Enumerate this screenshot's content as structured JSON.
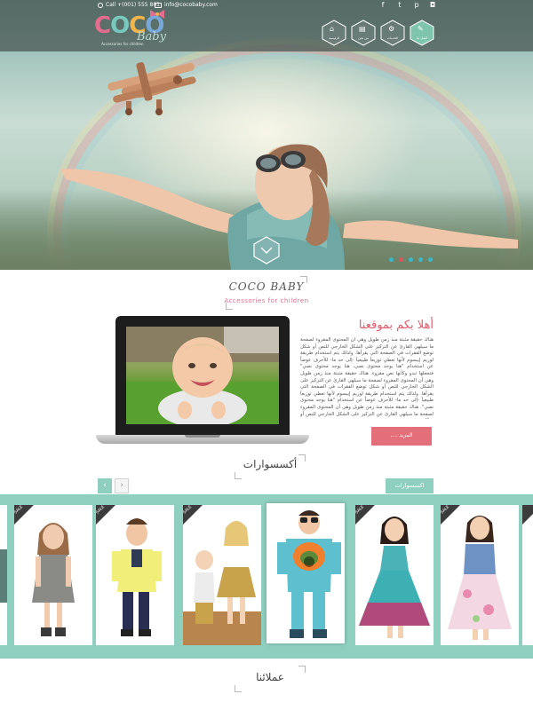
{
  "topbar": {
    "phone": "Call +(001) 555 801",
    "email": "info@cocobaby.com",
    "social": [
      {
        "name": "facebook-icon",
        "glyph": "f"
      },
      {
        "name": "twitter-icon",
        "glyph": "t"
      },
      {
        "name": "pinterest-icon",
        "glyph": "p"
      },
      {
        "name": "instagram-icon",
        "glyph": "◘"
      }
    ],
    "nav": [
      {
        "name": "nav-home",
        "label": "الرئيسية",
        "glyph": "⌂"
      },
      {
        "name": "nav-about",
        "label": "من نحن",
        "glyph": "▤"
      },
      {
        "name": "nav-services",
        "label": "الخدمات",
        "glyph": "⚙"
      },
      {
        "name": "nav-contact",
        "label": "اتصل بنا",
        "glyph": "✎"
      }
    ]
  },
  "logo": {
    "letters": [
      "C",
      "O",
      "C",
      "O"
    ],
    "script": "Baby",
    "tagline": "Accessories for children"
  },
  "hero": {
    "slides": 5,
    "active_slide": 1
  },
  "brand": {
    "title": "COCO BABY",
    "subtitle": "Accessories for children"
  },
  "welcome": {
    "heading": "أهلا بكم بموقعنا",
    "body": "هناك حقيقة مثبتة منذ زمن طويل وهي أن المحتوى المقروء لصفحة ما سيلهي القارئ عن التركيز على الشكل الخارجي للنص أو شكل توضع الفقرات في الصفحة التي يقرأها. ولذلك يتم استخدام طريقة لوريم إيبسوم لأنها تعطي توزيعاَ طبيعياَ -إلى حد ما- للأحرف عوضاً عن استخدام \"هنا يوجد محتوى نصي، هنا يوجد محتوى نصي\" فتجعلها تبدو وكأنها نص مقروء. هناك حقيقة مثبتة منذ زمن طويل وهي أن المحتوى المقروء لصفحة ما سيلهي القارئ عن التركيز على الشكل الخارجي للنص أو شكل توضع الفقرات في الصفحة التي يقرأها. ولذلك يتم استخدام طريقة لوريم إيبسوم لأنها تعطي توزيعاَ طبيعياَ -إلى حد ما- للأحرف عوضاً عن استخدام \"هنا يوجد محتوى نصي\". هناك حقيقة مثبتة منذ زمن طويل وهي أن المحتوى المقروء لصفحة ما سيلهي القارئ عن التركيز على الشكل الخارجي للنص أو شكل توضع",
    "button": "المزيد ....."
  },
  "accessories": {
    "title": "أكسسوارات",
    "tab": "اكسسوارات",
    "prev": "‹",
    "next": "›",
    "sale_label": "SALE",
    "items": [
      {
        "name": "product-girl-gray-dress",
        "sale": false
      },
      {
        "name": "product-girl-gray-dress",
        "sale": true
      },
      {
        "name": "product-boy-yellow-shirt",
        "sale": true
      },
      {
        "name": "product-siblings-outfit",
        "sale": true
      },
      {
        "name": "product-boy-blue-jumpsuit",
        "sale": false
      },
      {
        "name": "product-girl-teal-dress",
        "sale": true
      },
      {
        "name": "product-girl-floral-dress",
        "sale": true
      },
      {
        "name": "product-partial",
        "sale": true
      }
    ]
  },
  "clients": {
    "title": "عملائنا"
  },
  "colors": {
    "accent": "#e36f7b",
    "mint": "#8fcfbf",
    "topbar": "#46544f"
  }
}
